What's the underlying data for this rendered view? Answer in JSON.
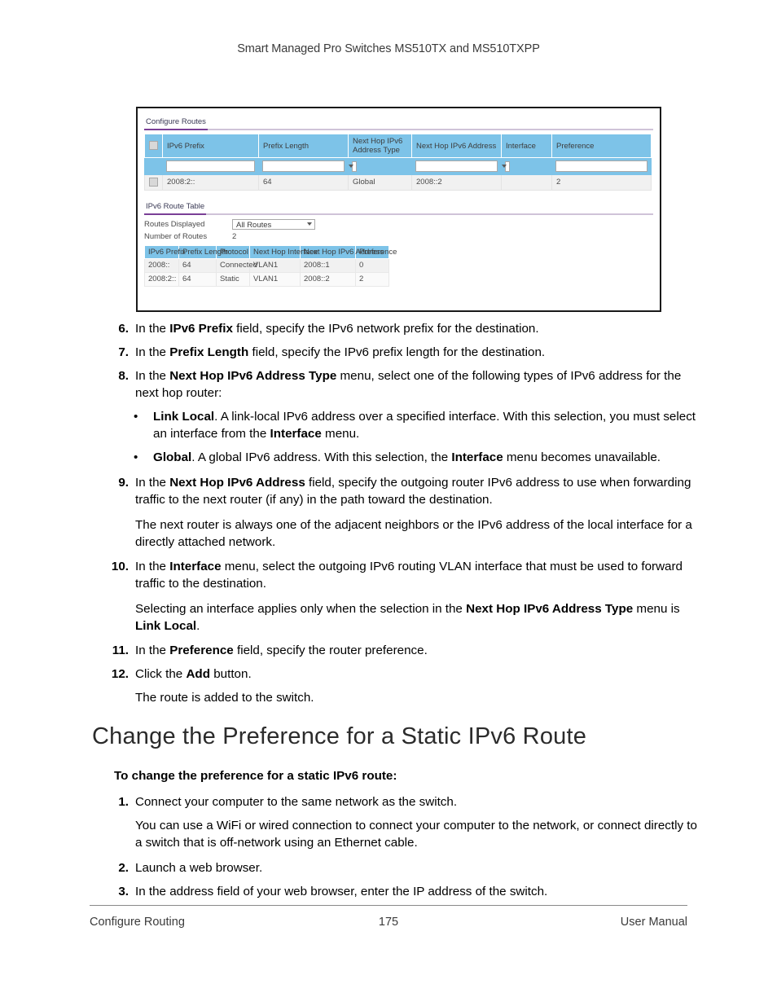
{
  "header": {
    "running_head": "Smart Managed Pro Switches MS510TX and MS510TXPP"
  },
  "screenshot": {
    "configure_routes": {
      "tab_label": "Configure Routes",
      "columns": [
        "IPv6 Prefix",
        "Prefix Length",
        "Next Hop IPv6 Address Type",
        "Next Hop IPv6 Address",
        "Interface",
        "Preference"
      ],
      "column_parts": {
        "next_hop_type_line1": "Next Hop IPv6",
        "next_hop_type_line2": "Address Type"
      },
      "input_row": {
        "ipv6_prefix": "",
        "prefix_length": "",
        "next_hop_type": "",
        "next_hop_address": "",
        "interface": "",
        "preference": ""
      },
      "rows": [
        {
          "ipv6_prefix": "2008:2::",
          "prefix_length": "64",
          "next_hop_type": "Global",
          "next_hop_address": "2008::2",
          "interface": "",
          "preference": "2"
        }
      ]
    },
    "route_table": {
      "tab_label": "IPv6 Route Table",
      "routes_displayed_label": "Routes Displayed",
      "routes_displayed_value": "All Routes",
      "number_of_routes_label": "Number of Routes",
      "number_of_routes_value": "2",
      "columns": [
        "IPv6 Prefix",
        "Prefix Length",
        "Protocol",
        "Next Hop Interface",
        "Next Hop IPv6 Address",
        "Preference"
      ],
      "rows": [
        {
          "ipv6_prefix": "2008::",
          "prefix_length": "64",
          "protocol": "Connected",
          "next_hop_interface": "VLAN1",
          "next_hop_address": "2008::1",
          "preference": "0"
        },
        {
          "ipv6_prefix": "2008:2::",
          "prefix_length": "64",
          "protocol": "Static",
          "next_hop_interface": "VLAN1",
          "next_hop_address": "2008::2",
          "preference": "2"
        }
      ]
    }
  },
  "steps": [
    {
      "num": "6.",
      "html": "In the <b>IPv6 Prefix</b> field, specify the IPv6 network prefix for the destination."
    },
    {
      "num": "7.",
      "html": "In the <b>Prefix Length</b> field, specify the IPv6 prefix length for the destination."
    },
    {
      "num": "8.",
      "html": "In the <b>Next Hop IPv6 Address Type</b> menu, select one of the following types of IPv6 address for the next hop router:"
    }
  ],
  "bullets": [
    {
      "marker": "•",
      "html": "<b>Link Local</b>. A link-local IPv6 address over a specified interface. With this selection, you must select an interface from the <b>Interface</b> menu."
    },
    {
      "marker": "•",
      "html": "<b>Global</b>. A global IPv6 address. With this selection, the <b>Interface</b> menu becomes unavailable."
    }
  ],
  "steps_cont": [
    {
      "num": "9.",
      "html": "In the <b>Next Hop IPv6 Address</b> field, specify the outgoing router IPv6 address to use when forwarding traffic to the next router (if any) in the path toward the destination."
    }
  ],
  "paragraph_9": "The next router is always one of the adjacent neighbors or the IPv6 address of the local interface for a directly attached network.",
  "steps_10": [
    {
      "num": "10.",
      "html": "In the <b>Interface</b> menu, select the outgoing IPv6 routing VLAN interface that must be used to forward traffic to the destination."
    }
  ],
  "paragraph_10": "Selecting an interface applies only when the selection in the <b>Next Hop IPv6 Address Type</b> menu is <b>Link Local</b>.",
  "steps_11_12": [
    {
      "num": "11.",
      "html": "In the <b>Preference</b> field, specify the router preference."
    },
    {
      "num": "12.",
      "html": "Click the <b>Add</b> button."
    }
  ],
  "paragraph_12": "The route is added to the switch.",
  "section": {
    "title": "Change the Preference for a Static IPv6 Route",
    "lead_in": "To change the preference for a static IPv6 route:"
  },
  "steps_section": [
    {
      "num": "1.",
      "html": "Connect your computer to the same network as the switch."
    }
  ],
  "paragraph_s1": "You can use a WiFi or wired connection to connect your computer to the network, or connect directly to a switch that is off-network using an Ethernet cable.",
  "steps_section2": [
    {
      "num": "2.",
      "html": "Launch a web browser."
    },
    {
      "num": "3.",
      "html": "In the address field of your web browser, enter the IP address of the switch."
    }
  ],
  "footer": {
    "left": "Configure Routing",
    "center": "175",
    "right": "User Manual"
  }
}
